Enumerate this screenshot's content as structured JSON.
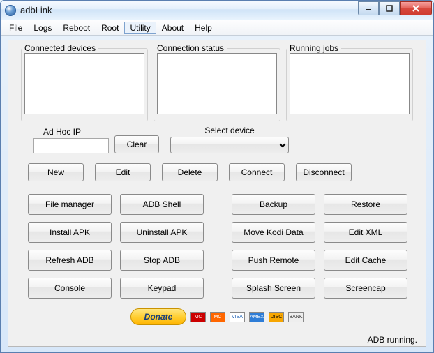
{
  "window": {
    "title": "adbLink"
  },
  "menu": {
    "items": [
      "File",
      "Logs",
      "Reboot",
      "Root",
      "Utility",
      "About",
      "Help"
    ],
    "active_index": 4
  },
  "panels": {
    "connected": "Connected devices",
    "status": "Connection status",
    "jobs": "Running jobs"
  },
  "adhoc": {
    "ip_label": "Ad Hoc IP",
    "ip_value": "",
    "clear": "Clear",
    "select_label": "Select device",
    "select_value": ""
  },
  "conn_buttons": {
    "new": "New",
    "edit": "Edit",
    "delete": "Delete",
    "connect": "Connect",
    "disconnect": "Disconnect"
  },
  "tools_left": [
    "File manager",
    "ADB Shell",
    "Install APK",
    "Uninstall APK",
    "Refresh ADB",
    "Stop ADB",
    "Console",
    "Keypad"
  ],
  "tools_right": [
    "Backup",
    "Restore",
    "Move Kodi Data",
    "Edit XML",
    "Push Remote",
    "Edit Cache",
    "Splash Screen",
    "Screencap"
  ],
  "donate": {
    "label": "Donate"
  },
  "cards": [
    "MC",
    "MC",
    "VISA",
    "AMEX",
    "DISC",
    "BANK"
  ],
  "status": "ADB running."
}
